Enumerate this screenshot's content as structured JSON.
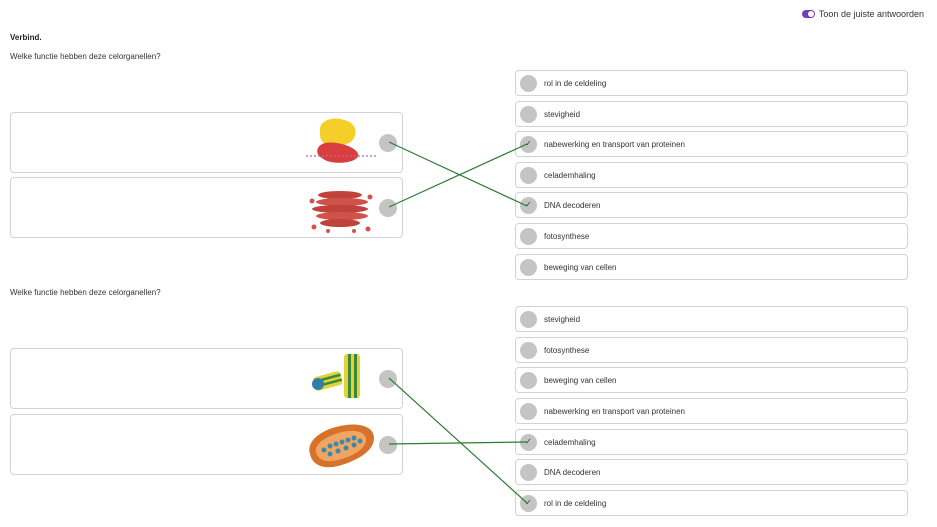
{
  "header": {
    "toggle_label": "Toon de juiste antwoorden"
  },
  "title": "Verbind.",
  "questions": [
    {
      "prompt": "Welke functie hebben deze celorganellen?",
      "answers": [
        {
          "label": "rol in de celdeling",
          "checked": false
        },
        {
          "label": "stevigheid",
          "checked": false
        },
        {
          "label": "nabewerking en transport van proteinen",
          "checked": true
        },
        {
          "label": "celademhaling",
          "checked": false
        },
        {
          "label": "DNA decoderen",
          "checked": true
        },
        {
          "label": "fotosynthese",
          "checked": false
        },
        {
          "label": "beweging van cellen",
          "checked": false
        }
      ]
    },
    {
      "prompt": "Welke functie hebben deze celorganellen?",
      "answers": [
        {
          "label": "stevigheid",
          "checked": false
        },
        {
          "label": "fotosynthese",
          "checked": false
        },
        {
          "label": "beweging van cellen",
          "checked": false
        },
        {
          "label": "nabewerking en transport van proteinen",
          "checked": false
        },
        {
          "label": "celademhaling",
          "checked": true
        },
        {
          "label": "DNA decoderen",
          "checked": false
        },
        {
          "label": "rol in de celdeling",
          "checked": true
        }
      ]
    }
  ],
  "colors": {
    "connector": "#2f7a32",
    "accent": "#6f3fb6"
  }
}
